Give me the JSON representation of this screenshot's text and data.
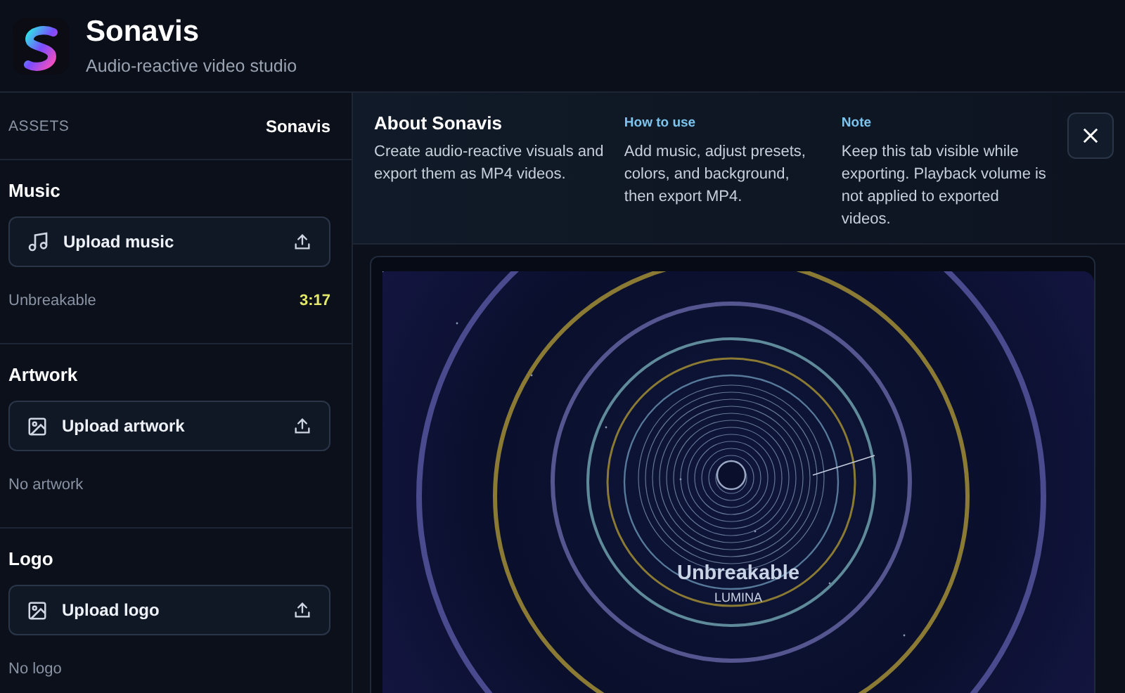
{
  "app": {
    "name": "Sonavis",
    "subtitle": "Audio-reactive video studio"
  },
  "sidebar": {
    "heading": "ASSETS",
    "project": "Sonavis",
    "sections": [
      {
        "title": "Music",
        "kind": "music",
        "button": "Upload music",
        "status": "Unbreakable",
        "duration": "3:17"
      },
      {
        "title": "Artwork",
        "kind": "image",
        "button": "Upload artwork",
        "status": "No artwork"
      },
      {
        "title": "Logo",
        "kind": "image",
        "button": "Upload logo",
        "status": "No logo"
      }
    ]
  },
  "about": {
    "title": "About Sonavis",
    "text": "Create audio-reactive visuals and export them as MP4 videos.",
    "columns": [
      {
        "heading": "How to use",
        "text": "Add music, adjust presets, colors, and background, then export MP4."
      },
      {
        "heading": "Note",
        "text": "Keep this tab visible while exporting. Playback volume is not applied to exported videos."
      }
    ]
  },
  "preview": {
    "title": "Unbreakable",
    "artist": "LUMINA"
  }
}
